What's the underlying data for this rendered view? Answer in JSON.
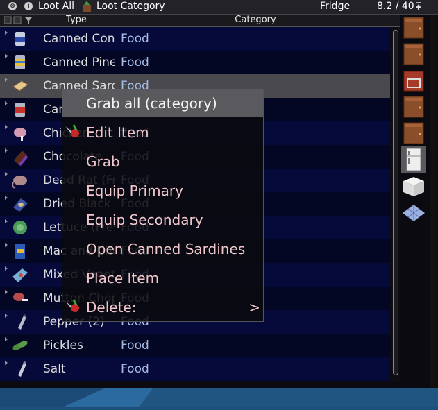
{
  "titlebar": {
    "close_glyph": "⊗",
    "info_glyph": "i",
    "loot_all": "Loot All",
    "loot_category": "Loot Category",
    "container_name": "Fridge",
    "capacity": "8.2 / 40"
  },
  "header": {
    "type": "Type",
    "category": "Category"
  },
  "items": [
    {
      "name": "Canned Condensed Milk",
      "category": "Food",
      "icon": "milk-can-icon"
    },
    {
      "name": "Canned Pineapple",
      "category": "Food",
      "icon": "pineapple-can-icon"
    },
    {
      "name": "Canned Sardines",
      "category": "Food",
      "icon": "sardines-tin-icon"
    },
    {
      "name": "Canned Tomato",
      "category": "Food",
      "icon": "tomato-can-icon"
    },
    {
      "name": "Chicken",
      "category": "Food",
      "icon": "chicken-icon"
    },
    {
      "name": "Chocolate",
      "category": "Food",
      "icon": "chocolate-icon"
    },
    {
      "name": "Dead Rat (Fresh)",
      "category": "Food",
      "icon": "dead-rat-icon"
    },
    {
      "name": "Dried Black Beans",
      "category": "Food",
      "icon": "beans-bag-icon"
    },
    {
      "name": "Lettuce (Fresh)",
      "category": "Food",
      "icon": "lettuce-icon"
    },
    {
      "name": "Mac and Cheese",
      "category": "Food",
      "icon": "mac-cheese-box-icon"
    },
    {
      "name": "Mixed Vegetables",
      "category": "Food",
      "icon": "mixed-veg-bag-icon"
    },
    {
      "name": "Mutton Chop",
      "category": "Food",
      "icon": "mutton-chop-icon"
    },
    {
      "name": "Pepper (2)",
      "category": "Food",
      "icon": "pepper-shaker-icon"
    },
    {
      "name": "Pickles",
      "category": "Food",
      "icon": "pickles-icon"
    },
    {
      "name": "Salt",
      "category": "Food",
      "icon": "salt-shaker-icon"
    }
  ],
  "context_menu": [
    {
      "label": "Grab all (category)",
      "icon": ""
    },
    {
      "label": "Edit Item",
      "icon": "debug-tool-icon"
    },
    {
      "label": "Grab",
      "icon": ""
    },
    {
      "label": "Equip Primary",
      "icon": ""
    },
    {
      "label": "Equip Secondary",
      "icon": ""
    },
    {
      "label": "Open Canned Sardines",
      "icon": ""
    },
    {
      "label": "Place Item",
      "icon": ""
    },
    {
      "label": "Delete:",
      "icon": "debug-tool-icon",
      "submenu_glyph": ">"
    }
  ],
  "side_containers": [
    {
      "icon": "wooden-cabinet-icon",
      "selected": false
    },
    {
      "icon": "wooden-cabinet-icon",
      "selected": false
    },
    {
      "icon": "stove-icon",
      "selected": false
    },
    {
      "icon": "wooden-cabinet-icon",
      "selected": false
    },
    {
      "icon": "wooden-cabinet-icon",
      "selected": false
    },
    {
      "icon": "fridge-icon",
      "selected": true
    },
    {
      "icon": "counter-icon",
      "selected": false
    },
    {
      "icon": "floor-tile-icon",
      "selected": false
    }
  ],
  "colors": {
    "row_odd": "#060a3a",
    "row_even": "#040724",
    "row_selected": "#4a4a4e",
    "category_text": "#a7bde6",
    "menu_text": "#f0c6cc"
  }
}
